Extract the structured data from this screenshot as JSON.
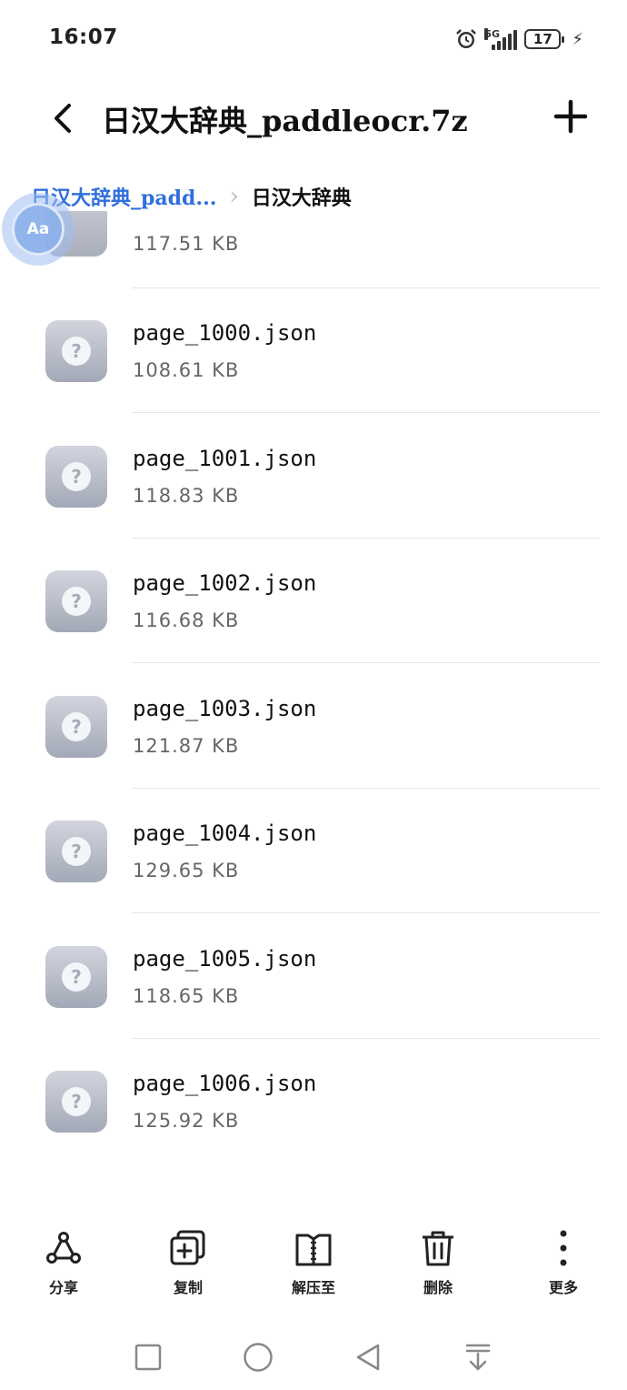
{
  "status_bar": {
    "time": "16:07",
    "network": "5G",
    "battery": "17"
  },
  "header": {
    "title": "日汉大辞典_paddleocr.7z",
    "back_icon": "chevron-left-icon",
    "add_icon": "plus-icon"
  },
  "breadcrumb": {
    "parent": "日汉大辞典_padd...",
    "current": "日汉大辞典"
  },
  "floating_button": {
    "label": "Aa"
  },
  "files": {
    "partial_size": "117.51 KB",
    "items": [
      {
        "name": "page_1000.json",
        "size": "108.61 KB"
      },
      {
        "name": "page_1001.json",
        "size": "118.83 KB"
      },
      {
        "name": "page_1002.json",
        "size": "116.68 KB"
      },
      {
        "name": "page_1003.json",
        "size": "121.87 KB"
      },
      {
        "name": "page_1004.json",
        "size": "129.65 KB"
      },
      {
        "name": "page_1005.json",
        "size": "118.65 KB"
      },
      {
        "name": "page_1006.json",
        "size": "125.92 KB"
      }
    ]
  },
  "actions": [
    {
      "label": "分享",
      "icon": "share-icon"
    },
    {
      "label": "复制",
      "icon": "copy-icon"
    },
    {
      "label": "解压至",
      "icon": "extract-icon"
    },
    {
      "label": "删除",
      "icon": "trash-icon"
    },
    {
      "label": "更多",
      "icon": "more-vertical-icon"
    }
  ],
  "colors": {
    "accent": "#2f6fde",
    "thumb": "#a2a8b6"
  }
}
